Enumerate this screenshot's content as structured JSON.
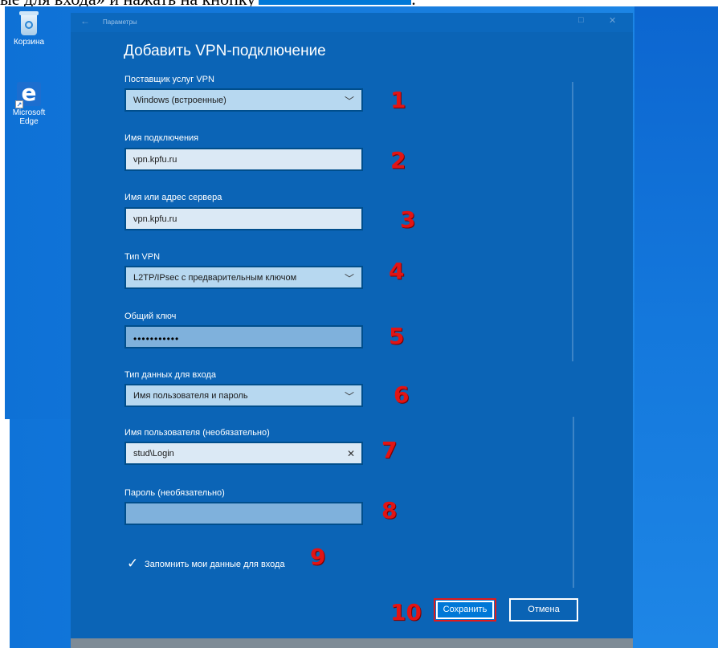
{
  "doc_text": {
    "before": "ые для входа» и нажать на кнопку",
    "after": "."
  },
  "desktop": {
    "icons": [
      {
        "label": "Корзина",
        "icon": "recycle-bin-icon"
      },
      {
        "label": "Microsoft Edge",
        "icon": "edge-icon"
      }
    ]
  },
  "window": {
    "title": "Параметры",
    "heading": "Добавить VPN-подключение",
    "fields": {
      "provider": {
        "label": "Поставщик услуг VPN",
        "value": "Windows (встроенные)"
      },
      "connection_name": {
        "label": "Имя подключения",
        "value": "vpn.kpfu.ru"
      },
      "server": {
        "label": "Имя или адрес сервера",
        "value": "vpn.kpfu.ru"
      },
      "vpn_type": {
        "label": "Тип VPN",
        "value": "L2TP/IPsec с предварительным ключом"
      },
      "shared_key": {
        "label": "Общий ключ",
        "value": "•••••••••••"
      },
      "signin_type": {
        "label": "Тип данных для входа",
        "value": "Имя пользователя и пароль"
      },
      "username": {
        "label": "Имя пользователя (необязательно)",
        "value": "stud\\Login"
      },
      "password": {
        "label": "Пароль (необязательно)",
        "value": ""
      }
    },
    "remember": {
      "label": "Запомнить мои данные для входа",
      "checked": true
    },
    "buttons": {
      "save": "Сохранить",
      "cancel": "Отмена"
    }
  },
  "annotations": [
    "1",
    "2",
    "3",
    "4",
    "5",
    "6",
    "7",
    "8",
    "9",
    "10"
  ],
  "colors": {
    "accent": "#0078d7",
    "window_bg": "#0b64b6",
    "annotation_red": "#e21414"
  }
}
